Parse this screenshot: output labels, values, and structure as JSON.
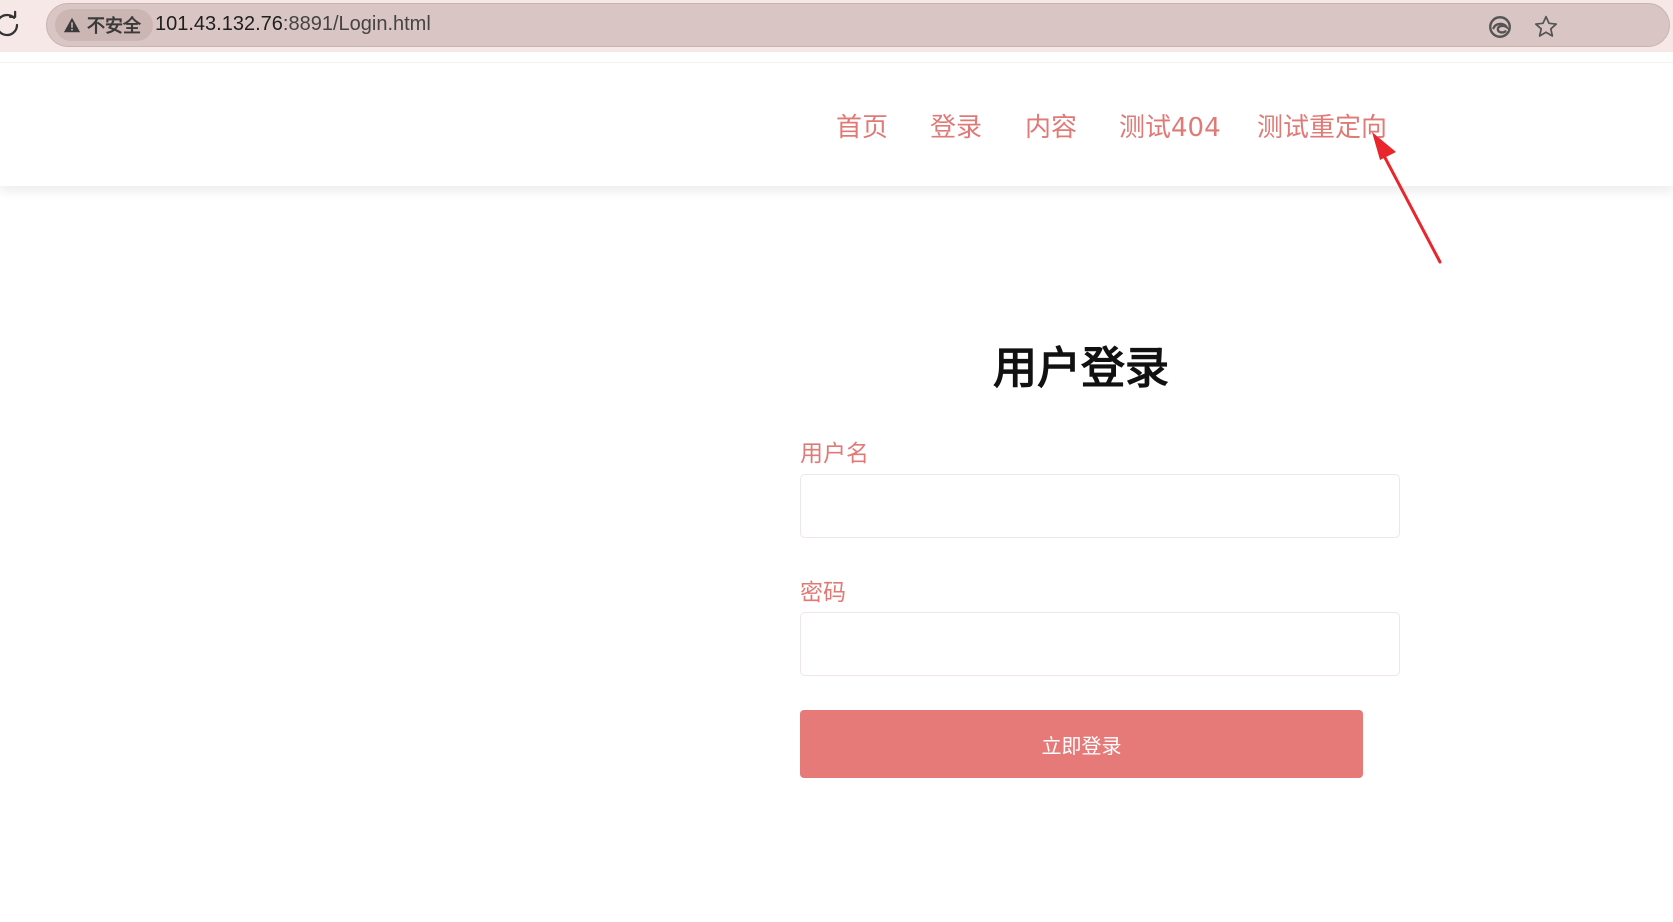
{
  "browser": {
    "security_label": "不安全",
    "url_host": "101.43.132.76",
    "url_rest": ":8891/Login.html"
  },
  "nav": {
    "items": [
      {
        "label": "首页"
      },
      {
        "label": "登录"
      },
      {
        "label": "内容"
      },
      {
        "label": "测试404"
      },
      {
        "label": "测试重定向"
      }
    ],
    "color": "#e07a77"
  },
  "login": {
    "title": "用户登录",
    "username_label": "用户名",
    "username_value": "",
    "password_label": "密码",
    "password_value": "",
    "submit_label": "立即登录",
    "button_color": "#e57a79"
  },
  "annotation": {
    "arrow_color": "#e8262c"
  },
  "icons": {
    "reload": "reload-icon",
    "warning": "warning-icon",
    "edge": "edge-icon",
    "favorite": "star-icon"
  }
}
